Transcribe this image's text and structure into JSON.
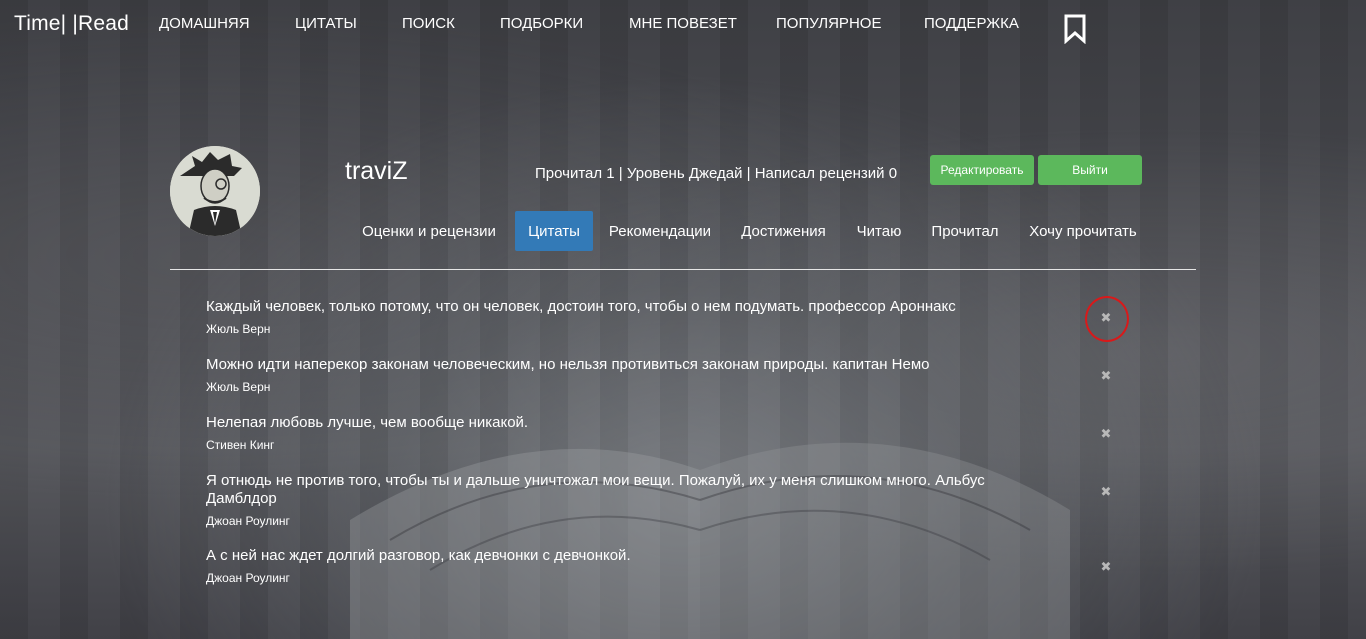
{
  "nav": {
    "brand": "Time| |Read",
    "items": [
      "ДОМАШНЯЯ",
      "ЦИТАТЫ",
      "ПОИСК",
      "ПОДБОРКИ",
      "МНЕ ПОВЕЗЕТ",
      "ПОПУЛЯРНОЕ",
      "ПОДДЕРЖКА"
    ],
    "bookmark_icon": "bookmark-icon"
  },
  "profile": {
    "username": "traviZ",
    "stats": "Прочитал 1 | Уровень Джедай | Написал рецензий 0",
    "edit_label": "Редактировать",
    "logout_label": "Выйти",
    "accent_green": "#5cb85c"
  },
  "tabs": {
    "items": [
      "Оценки и рецензии",
      "Цитаты",
      "Рекомендации",
      "Достижения",
      "Читаю",
      "Прочитал",
      "Хочу прочитать"
    ],
    "active": "Цитаты",
    "accent_blue": "#337ab7"
  },
  "quotes": [
    {
      "text": "Каждый человек, только потому, что он человек, достоин того, чтобы о нем подумать. профессор Ароннакс",
      "author": "Жюль Верн"
    },
    {
      "text": "Можно идти наперекор законам человеческим, но нельзя противиться законам природы. капитан Немо",
      "author": "Жюль Верн"
    },
    {
      "text": "Нелепая любовь лучше, чем вообще никакой.",
      "author": "Стивен Кинг"
    },
    {
      "text": "Я отнюдь не против того, чтобы ты и дальше уничтожал мои вещи. Пожалуй, их у меня слишком много. Альбус Дамблдор",
      "author": "Джоан Роулинг"
    },
    {
      "text": "А с ней нас ждет долгий разговор, как девчонки с девчонкой.",
      "author": "Джоан Роулинг"
    }
  ],
  "delete_icon": "✖"
}
